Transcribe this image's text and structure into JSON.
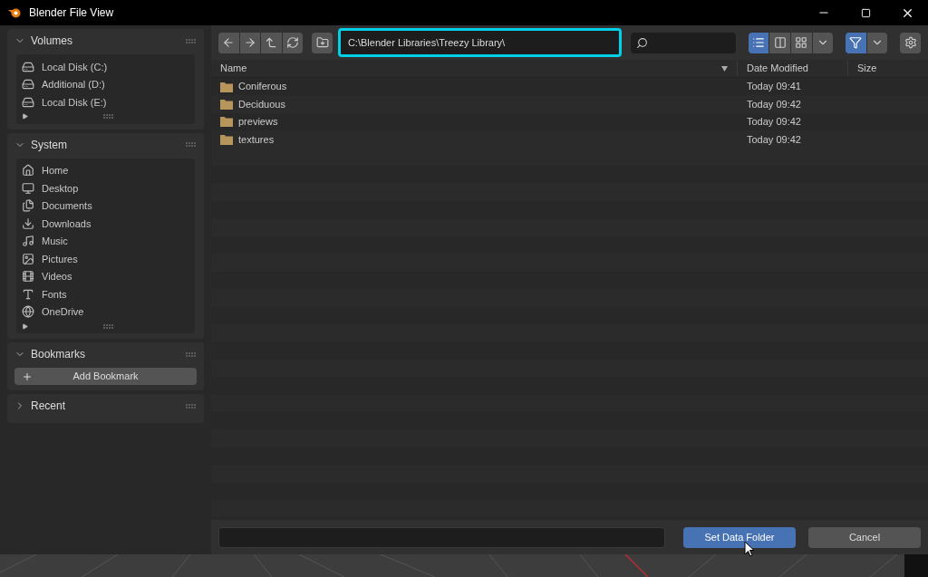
{
  "window": {
    "title": "Blender File View"
  },
  "sidebar": {
    "panels": [
      {
        "title": "Volumes",
        "expanded": true,
        "kind": "list",
        "items": [
          {
            "label": "Local Disk (C:)"
          },
          {
            "label": "Additional (D:)"
          },
          {
            "label": "Local Disk (E:)"
          }
        ]
      },
      {
        "title": "System",
        "expanded": true,
        "kind": "list",
        "items": [
          {
            "label": "Home"
          },
          {
            "label": "Desktop"
          },
          {
            "label": "Documents"
          },
          {
            "label": "Downloads"
          },
          {
            "label": "Music"
          },
          {
            "label": "Pictures"
          },
          {
            "label": "Videos"
          },
          {
            "label": "Fonts"
          },
          {
            "label": "OneDrive"
          }
        ]
      },
      {
        "title": "Bookmarks",
        "expanded": true,
        "kind": "action",
        "button": "Add Bookmark"
      },
      {
        "title": "Recent",
        "expanded": false
      }
    ]
  },
  "toolbar": {
    "path": "C:\\Blender Libraries\\Treezy Library\\",
    "display_modes": [
      {
        "selected": true
      },
      {
        "selected": false
      },
      {
        "selected": false
      }
    ],
    "filter": {
      "on": true
    }
  },
  "table": {
    "columns": [
      {
        "label": "Name"
      },
      {
        "label": "Date Modified"
      },
      {
        "label": "Size"
      }
    ],
    "rows": [
      {
        "name": "Coniferous",
        "date": "Today 09:41"
      },
      {
        "name": "Deciduous",
        "date": "Today 09:42"
      },
      {
        "name": "previews",
        "date": "Today 09:42"
      },
      {
        "name": "textures",
        "date": "Today 09:42"
      }
    ]
  },
  "buttons": [
    {
      "label": "Set Data Folder",
      "kind": "primary"
    },
    {
      "label": "Cancel",
      "kind": "secondary"
    }
  ]
}
